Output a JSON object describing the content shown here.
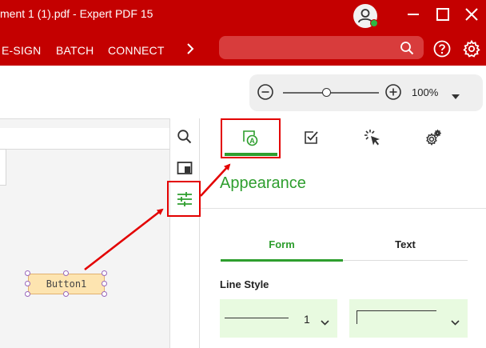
{
  "window": {
    "title": "ment 1 (1).pdf  -  Expert PDF 15"
  },
  "ribbon": {
    "menu": [
      {
        "label": "E-SIGN"
      },
      {
        "label": "BATCH"
      },
      {
        "label": "CONNECT"
      }
    ],
    "search": {
      "placeholder": ""
    }
  },
  "zoom": {
    "level": "100%",
    "slider_fraction": 0.45
  },
  "document": {
    "form_button_label": "Button1"
  },
  "panel": {
    "section_title": "Appearance",
    "tabs": [
      {
        "label": "Form",
        "active": true
      },
      {
        "label": "Text",
        "active": false
      }
    ],
    "line_style_label": "Line Style",
    "line_width_value": "1"
  },
  "colors": {
    "brand_red": "#c40000",
    "accent_green": "#2e9e2e",
    "highlight_red": "#e30000",
    "dropdown_bg": "#e8fae0"
  },
  "icons": {
    "titlebar": [
      "user-avatar-icon",
      "online-status-icon",
      "minimize-icon",
      "maximize-icon",
      "close-icon"
    ],
    "ribbon": [
      "chevron-right-icon",
      "search-icon",
      "help-icon",
      "settings-gear-icon"
    ],
    "strip": [
      "search-icon",
      "panel-icon",
      "sliders-icon"
    ],
    "panel_tabs": [
      "appearance-icon",
      "checkbox-icon",
      "actions-icon",
      "settings-gears-icon"
    ]
  }
}
